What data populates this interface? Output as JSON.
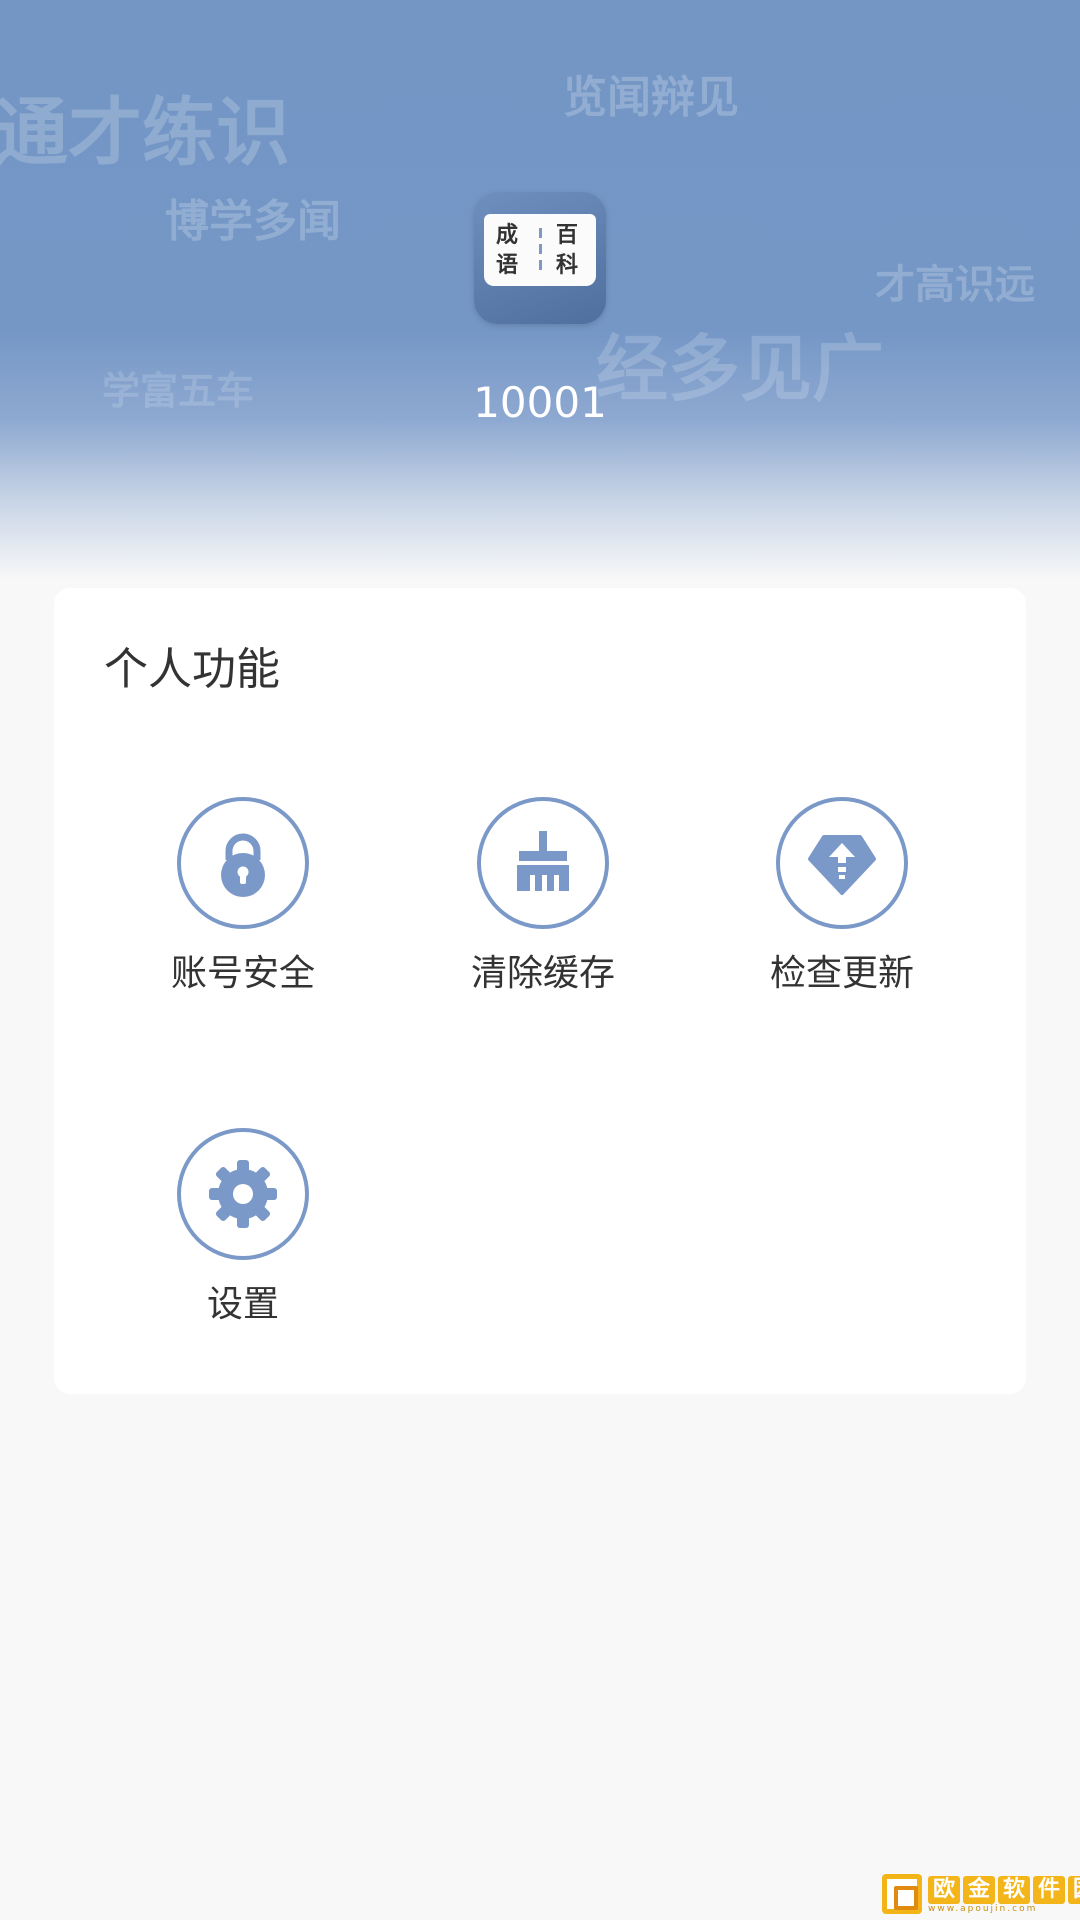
{
  "header": {
    "watermarks": [
      "通才练识",
      "览闻辩见",
      "博学多闻",
      "才高识远",
      "经多见广",
      "学富五车"
    ],
    "app_logo": {
      "icon": "book-icon",
      "glyphs": [
        "成",
        "语",
        "百",
        "科"
      ]
    },
    "user_id": "10001"
  },
  "personal": {
    "title": "个人功能",
    "items": [
      {
        "label": "账号安全",
        "icon": "lock-icon"
      },
      {
        "label": "清除缓存",
        "icon": "broom-icon"
      },
      {
        "label": "检查更新",
        "icon": "update-arrow-icon"
      },
      {
        "label": "设置",
        "icon": "gear-icon"
      }
    ]
  },
  "brand": {
    "chars": [
      "欧",
      "金",
      "软",
      "件",
      "园"
    ],
    "url": "www.apoujin.com"
  },
  "colors": {
    "accent": "#7b99c8",
    "header_blue": "#7396c5",
    "page_bg": "#f8f8f8",
    "card_bg": "#ffffff",
    "text": "#333333"
  }
}
